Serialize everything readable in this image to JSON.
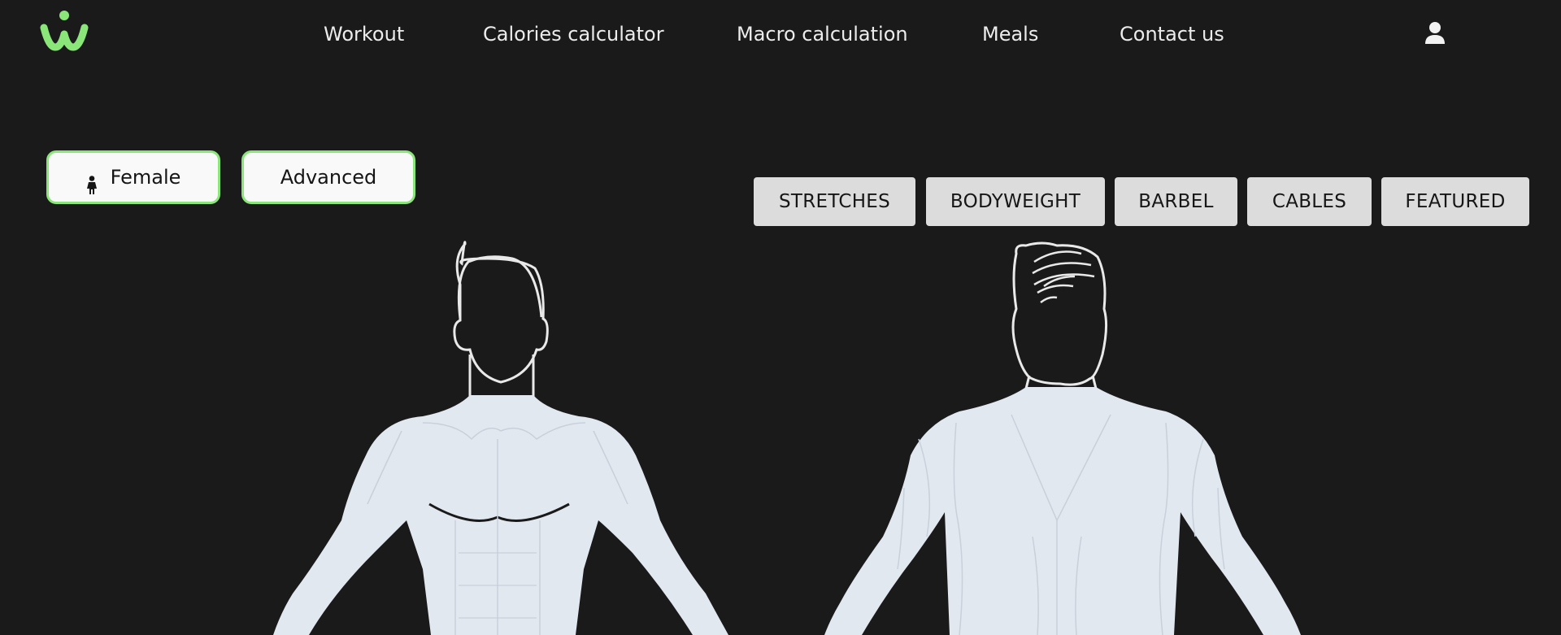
{
  "nav": {
    "items": [
      "Workout",
      "Calories calculator",
      "Macro calculation",
      "Meals",
      "Contact us"
    ]
  },
  "toggles": {
    "gender_label": "Female",
    "level_label": "Advanced"
  },
  "filters": [
    "STRETCHES",
    "BODYWEIGHT",
    "BARBEL",
    "CABLES",
    "FEATURED"
  ],
  "icons": {
    "logo": "brand-logo",
    "user": "user-icon",
    "gender": "female-icon"
  },
  "colors": {
    "background": "#1a1a1a",
    "accent": "#8be67a",
    "muscle_fill": "#e2e8f0",
    "filter_bg": "#dcdcdc"
  }
}
